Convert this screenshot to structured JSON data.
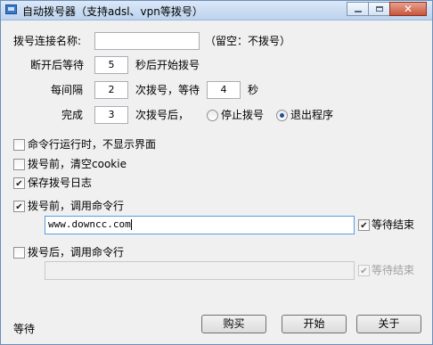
{
  "window": {
    "title": "自动拨号器（支持adsl、vpn等拨号）",
    "controls": {
      "minimize": "",
      "maximize": "",
      "close": "✕"
    }
  },
  "form": {
    "conn_name_label": "拨号连接名称:",
    "conn_name_value": "",
    "conn_name_hint": "（留空：不拨号）",
    "wait_prefix": "断开后等待",
    "wait_value": "5",
    "wait_suffix": "秒后开始拨号",
    "interval_prefix": "每间隔",
    "interval_value": "2",
    "interval_mid": "次拨号，等待",
    "interval_wait_value": "4",
    "interval_suffix": "秒",
    "done_prefix": "完成",
    "done_value": "3",
    "done_suffix": "次拨号后，",
    "radio_stop_label": "停止拨号",
    "radio_exit_label": "退出程序",
    "selected_action": "退出程序"
  },
  "options": {
    "hide_ui_label": "命令行运行时，不显示界面",
    "hide_ui_checked": false,
    "clear_cookie_label": "拨号前，清空cookie",
    "clear_cookie_checked": false,
    "save_log_label": "保存拨号日志",
    "save_log_checked": true,
    "pre_cmd_label": "拨号前，调用命令行",
    "pre_cmd_checked": true,
    "pre_cmd_value": "www.downcc.com",
    "pre_wait_label": "等待结束",
    "pre_wait_checked": true,
    "post_cmd_label": "拨号后，调用命令行",
    "post_cmd_checked": false,
    "post_cmd_value": "",
    "post_wait_label": "等待结束",
    "post_wait_checked": true
  },
  "footer": {
    "status": "等待",
    "buy_label": "购买",
    "start_label": "开始",
    "about_label": "关于"
  }
}
